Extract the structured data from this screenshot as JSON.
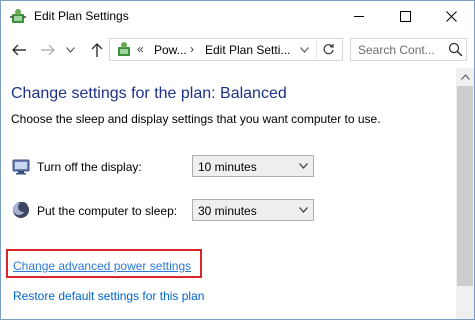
{
  "window": {
    "title": "Edit Plan Settings"
  },
  "nav": {
    "breadcrumb_sep": "«",
    "crumb_1": "Pow...",
    "crumb_sep": "›",
    "crumb_2": "Edit Plan Setti...",
    "search_placeholder": "Search Cont..."
  },
  "main": {
    "title": "Change settings for the plan: Balanced",
    "subtitle": "Choose the sleep and display settings that you want computer to use.",
    "settings": [
      {
        "label": "Turn off the display:",
        "value": "10 minutes",
        "icon": "monitor-icon"
      },
      {
        "label": "Put the computer to sleep:",
        "value": "30 minutes",
        "icon": "moon-icon"
      }
    ],
    "links": {
      "advanced": "Change advanced power settings",
      "restore": "Restore default settings for this plan"
    }
  },
  "colors": {
    "title_blue": "#1e3287",
    "link_blue": "#0066cc",
    "highlight_red": "#d8262d"
  },
  "icons": [
    "power-options-icon",
    "back-arrow-icon",
    "forward-arrow-icon",
    "chevron-down-icon",
    "up-arrow-icon",
    "refresh-icon",
    "search-icon",
    "minimize-icon",
    "maximize-icon",
    "close-icon"
  ]
}
